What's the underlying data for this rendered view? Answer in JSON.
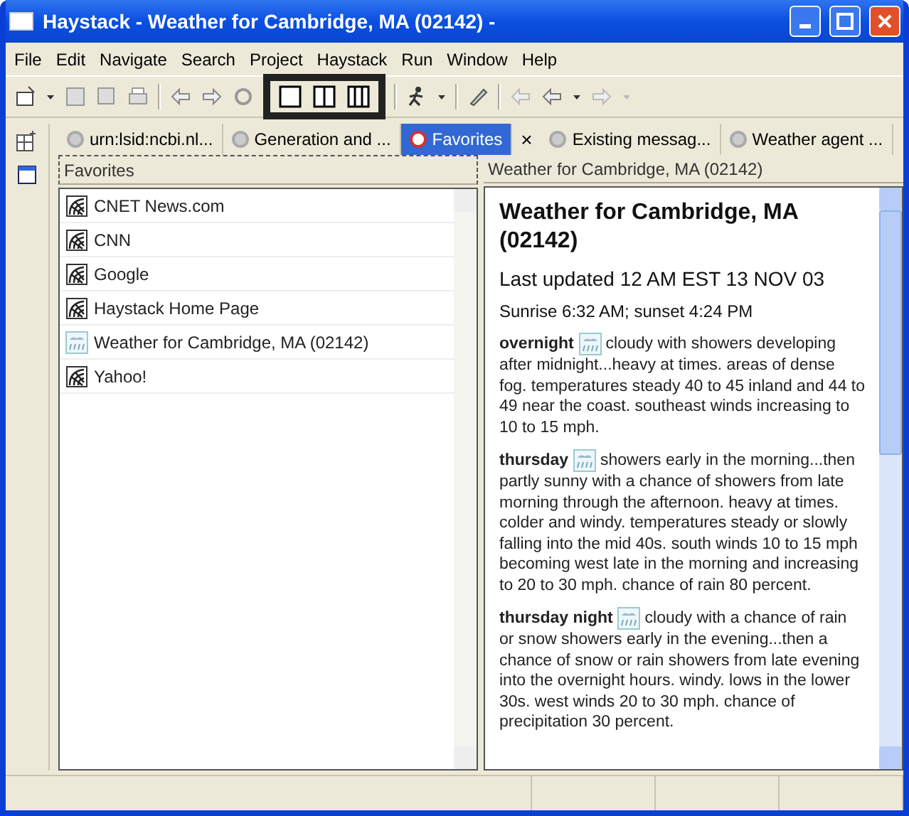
{
  "window": {
    "title": "Haystack - Weather for Cambridge, MA (02142) -"
  },
  "menu": [
    "File",
    "Edit",
    "Navigate",
    "Search",
    "Project",
    "Haystack",
    "Run",
    "Window",
    "Help"
  ],
  "tabs": [
    {
      "label": "urn:lsid:ncbi.nl...",
      "selected": false
    },
    {
      "label": "Generation and ...",
      "selected": false
    },
    {
      "label": "Favorites",
      "selected": true
    },
    {
      "label": "Existing messag...",
      "selected": false
    },
    {
      "label": "Weather agent ...",
      "selected": false
    }
  ],
  "tab_close": "×",
  "left_pane": {
    "title": "Favorites",
    "items": [
      {
        "label": "CNET News.com",
        "kind": "web"
      },
      {
        "label": "CNN",
        "kind": "web"
      },
      {
        "label": "Google",
        "kind": "web"
      },
      {
        "label": "Haystack Home Page",
        "kind": "web"
      },
      {
        "label": "Weather for Cambridge, MA (02142)",
        "kind": "weather"
      },
      {
        "label": "Yahoo!",
        "kind": "web"
      }
    ]
  },
  "right_pane": {
    "title": "Weather for Cambridge, MA (02142)",
    "heading": "Weather for Cambridge, MA (02142)",
    "updated": "Last updated 12 AM EST 13 NOV 03",
    "sun": "Sunrise 6:32 AM; sunset 4:24 PM",
    "forecasts": [
      {
        "period": "overnight",
        "text": "cloudy with showers developing after midnight...heavy at times. areas of dense fog. temperatures steady 40 to 45 inland and 44 to 49 near the coast. southeast winds increasing to 10 to 15 mph."
      },
      {
        "period": "thursday",
        "text": "showers early in the morning...then partly sunny with a chance of showers from late morning through the afternoon. heavy at times. colder and windy. temperatures steady or slowly falling into the mid 40s. south winds 10 to 15 mph becoming west late in the morning and increasing to 20 to 30 mph. chance of rain 80 percent."
      },
      {
        "period": "thursday night",
        "text": "cloudy with a chance of rain or snow showers early in the evening...then a chance of snow or rain showers from late evening into the overnight hours. windy. lows in the lower 30s. west winds 20 to 30 mph. chance of precipitation 30 percent."
      }
    ]
  }
}
